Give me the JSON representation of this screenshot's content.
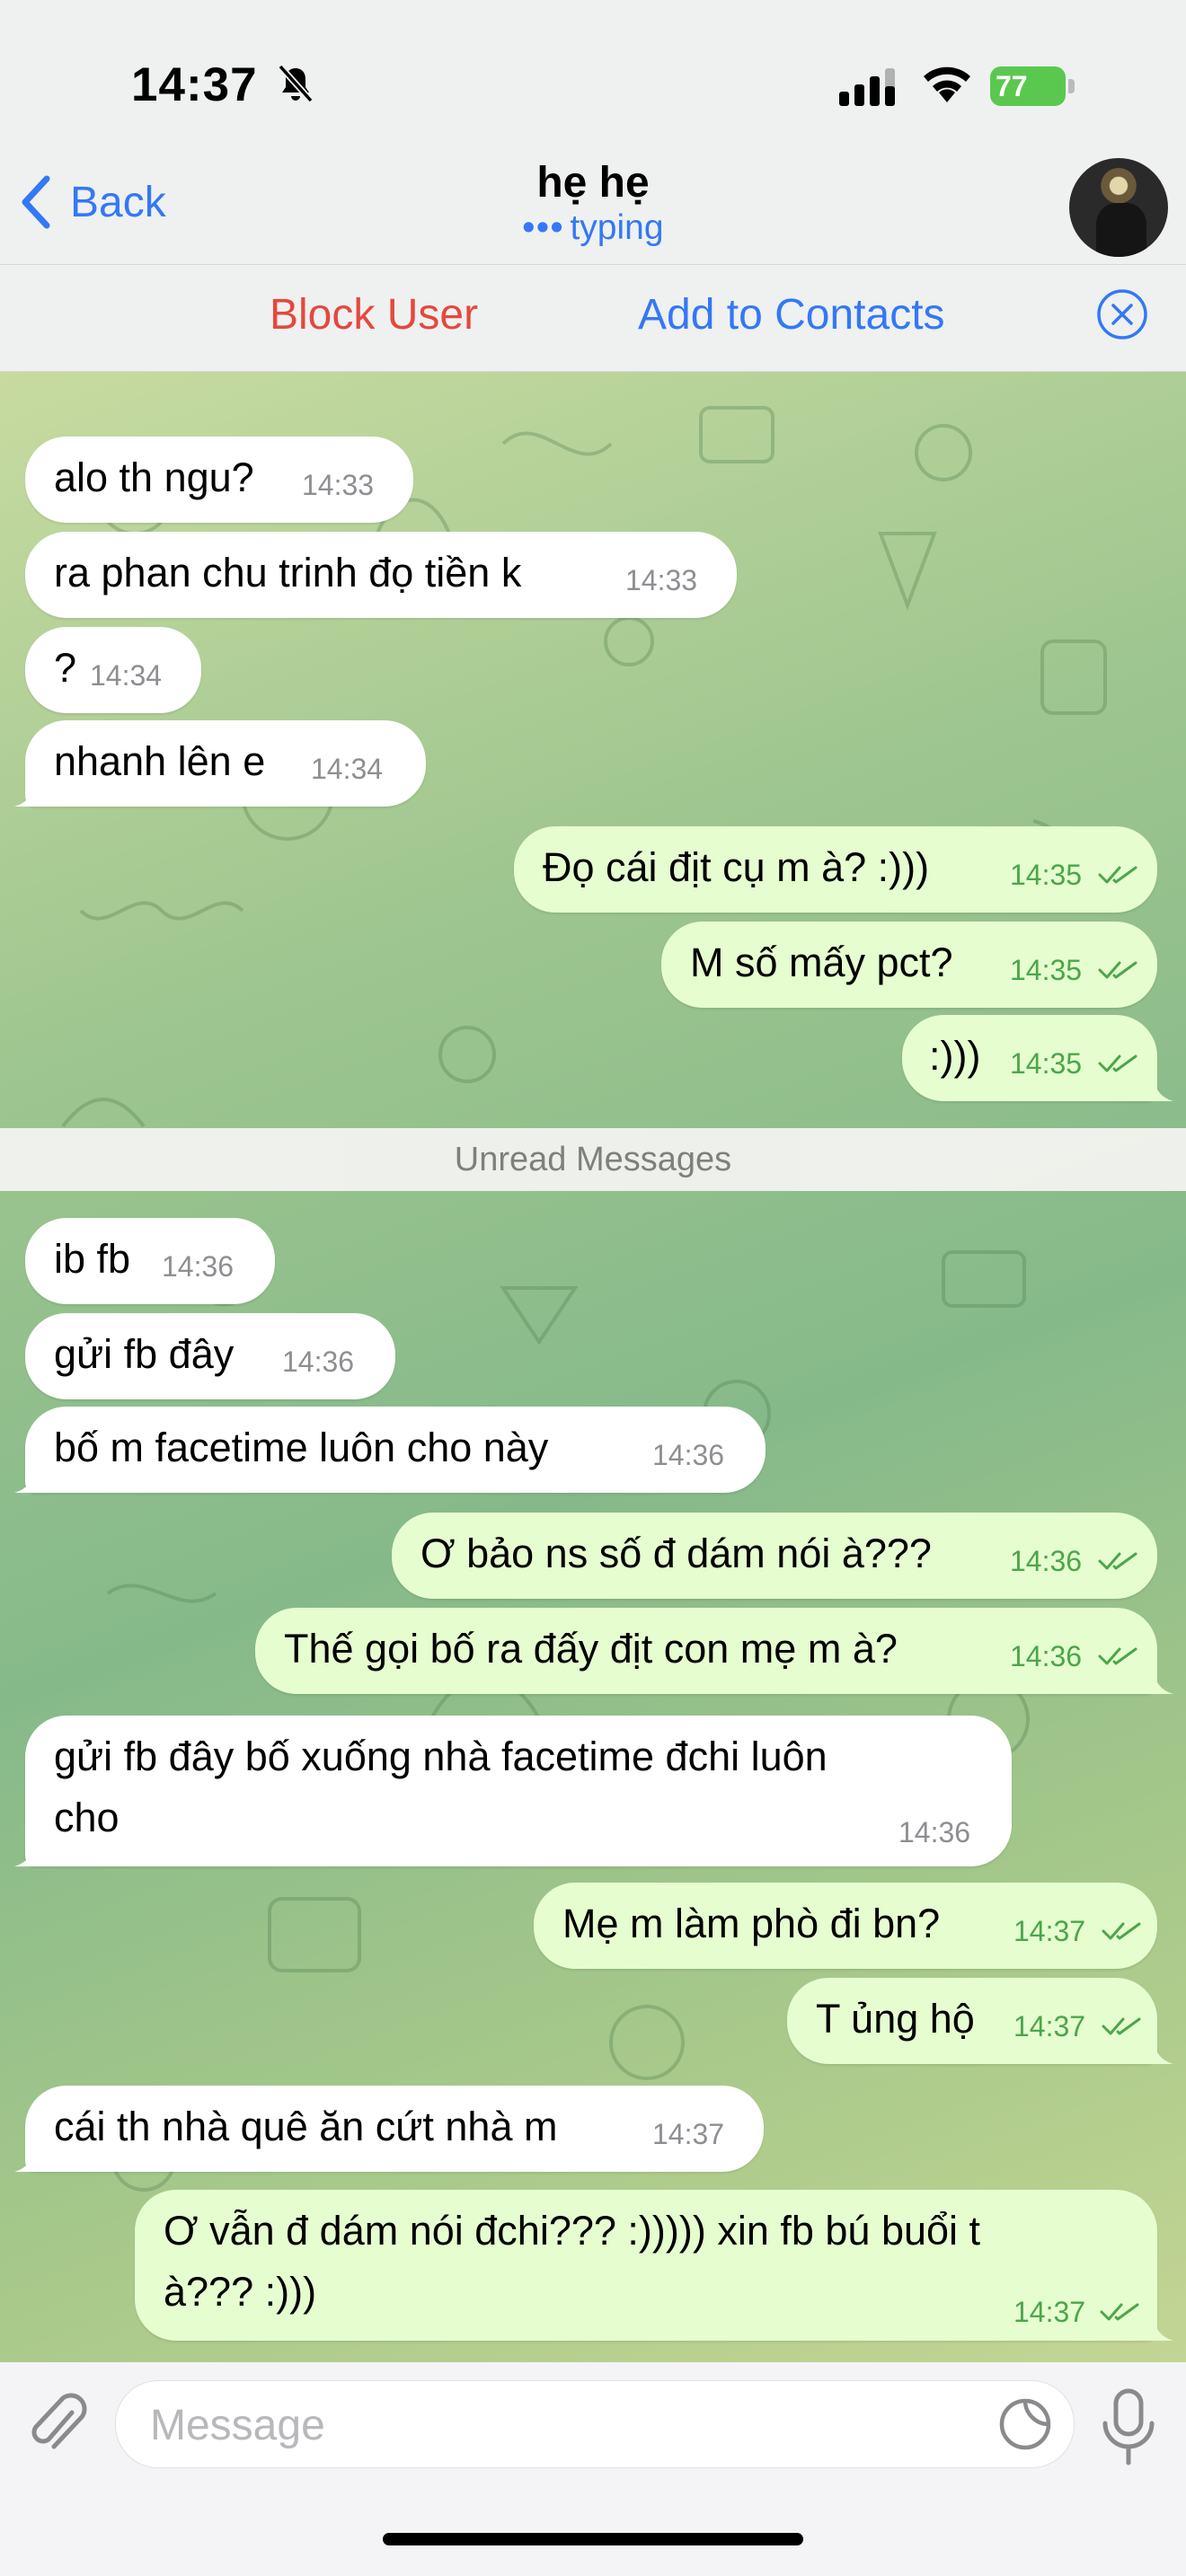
{
  "status_bar": {
    "time": "14:37",
    "battery": "77",
    "icons": [
      "bell-slash-icon",
      "signal-icon",
      "wifi-icon",
      "battery-icon"
    ]
  },
  "header": {
    "back_label": "Back",
    "title": "hẹ hẹ",
    "status": "typing",
    "status_dots": "•••"
  },
  "action_bar": {
    "block_label": "Block User",
    "add_label": "Add to Contacts"
  },
  "colors": {
    "accent": "#3478f6",
    "block_red": "#e5483e",
    "outgoing_bubble": "#e6fdd0",
    "incoming_bubble": "#ffffff",
    "outgoing_time": "#4ba64a"
  },
  "unread_divider": "Unread Messages",
  "messages": [
    {
      "dir": "in",
      "text": "alo th ngu?",
      "time": "14:33"
    },
    {
      "dir": "in",
      "text": "ra phan chu trinh đọ tiền k",
      "time": "14:33"
    },
    {
      "dir": "in",
      "text": "?",
      "time": "14:34"
    },
    {
      "dir": "in",
      "text": "nhanh lên e",
      "time": "14:34"
    },
    {
      "dir": "out",
      "text": "Đọ cái địt cụ m à? :)))",
      "time": "14:35",
      "read": true
    },
    {
      "dir": "out",
      "text": "M số mấy pct?",
      "time": "14:35",
      "read": true
    },
    {
      "dir": "out",
      "text": ":)))",
      "time": "14:35",
      "read": true
    },
    {
      "dir": "in",
      "text": "ib fb",
      "time": "14:36"
    },
    {
      "dir": "in",
      "text": "gửi fb đây",
      "time": "14:36"
    },
    {
      "dir": "in",
      "text": "bố m facetime luôn cho này",
      "time": "14:36"
    },
    {
      "dir": "out",
      "text": "Ơ bảo ns số đ dám nói à???",
      "time": "14:36",
      "read": true
    },
    {
      "dir": "out",
      "text": "Thế gọi bố ra đấy địt con mẹ m à?",
      "time": "14:36",
      "read": true
    },
    {
      "dir": "in",
      "line1": "gửi fb đây bố xuống nhà facetime đchi luôn",
      "line2": "cho",
      "time": "14:36"
    },
    {
      "dir": "out",
      "text": "Mẹ m làm phò đi bn?",
      "time": "14:37",
      "read": true
    },
    {
      "dir": "out",
      "text": "T ủng hộ",
      "time": "14:37",
      "read": true
    },
    {
      "dir": "in",
      "text": "cái th nhà quê ăn cứt nhà m",
      "time": "14:37"
    },
    {
      "dir": "out",
      "line1": "Ơ vẫn đ dám nói đchi??? :))))) xin fb bú buổi t",
      "line2": "à??? :)))",
      "time": "14:37",
      "read": true
    }
  ],
  "input": {
    "placeholder": "Message"
  }
}
